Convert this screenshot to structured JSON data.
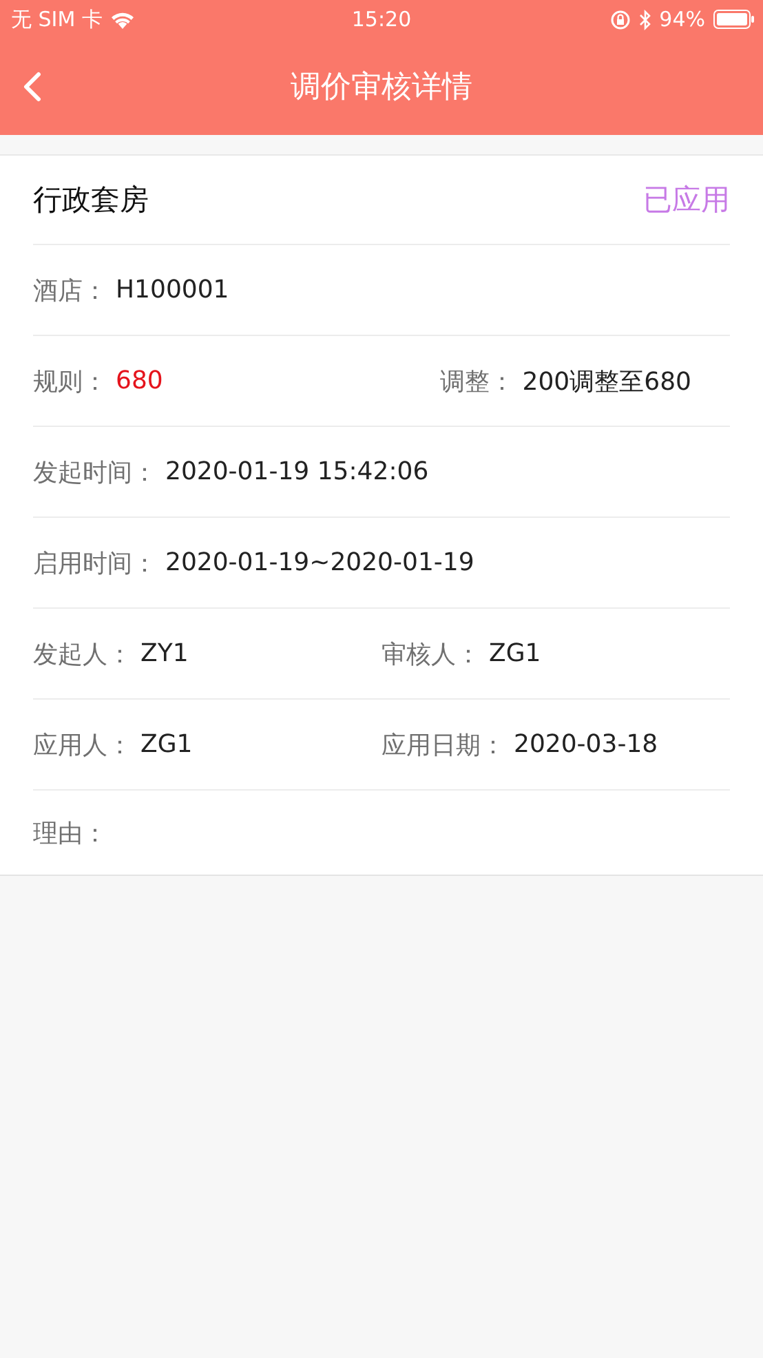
{
  "status_bar": {
    "carrier": "无 SIM 卡",
    "time": "15:20",
    "battery": "94%"
  },
  "nav": {
    "title": "调价审核详情"
  },
  "card": {
    "title": "行政套房",
    "status": "已应用",
    "rows": [
      {
        "kind": "pair",
        "fields": [
          {
            "label": "酒店：",
            "value": "H100001",
            "kind": "plain"
          }
        ]
      },
      {
        "kind": "spread",
        "fields": [
          {
            "label": "规则：",
            "value": "680",
            "kind": "alert"
          },
          {
            "label": "调整：",
            "value": "200调整至680",
            "kind": "plain"
          }
        ]
      },
      {
        "kind": "pair",
        "fields": [
          {
            "label": "发起时间：",
            "value": "2020-01-19 15:42:06",
            "kind": "plain"
          }
        ]
      },
      {
        "kind": "pair",
        "fields": [
          {
            "label": "启用时间：",
            "value": "2020-01-19~2020-01-19",
            "kind": "plain"
          }
        ]
      },
      {
        "kind": "pair",
        "fields": [
          {
            "label": "发起人：",
            "value": "ZY1",
            "kind": "plain"
          },
          {
            "label": "审核人：",
            "value": "ZG1",
            "kind": "plain"
          }
        ]
      },
      {
        "kind": "pair",
        "fields": [
          {
            "label": "应用人：",
            "value": "ZG1",
            "kind": "plain"
          },
          {
            "label": "应用日期：",
            "value": "2020-03-18",
            "kind": "plain"
          }
        ]
      },
      {
        "kind": "pair",
        "fields": [
          {
            "label": "理由："
          }
        ]
      }
    ]
  }
}
